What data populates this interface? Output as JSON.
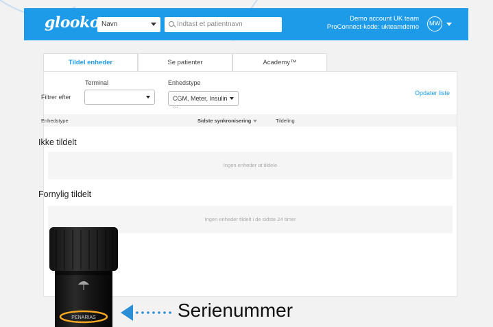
{
  "header": {
    "logo": "glooko",
    "filter_select": "Navn",
    "search_placeholder": "Indtast et patientnavn",
    "account_line1": "Demo account UK team",
    "account_line2": "ProConnect-kode: ukteamdemo",
    "avatar_initials": "MW",
    "color": "#1e9be8"
  },
  "tabs": [
    {
      "label": "Tildel enheder",
      "active": true
    },
    {
      "label": "Se patienter",
      "active": false
    },
    {
      "label": "Academy™",
      "active": false
    }
  ],
  "filters": {
    "filter_label": "Filtrer efter",
    "terminal_label": "Terminal",
    "terminal_value": "",
    "device_type_label": "Enhedstype",
    "device_type_value": "CGM, Meter, Insulin ...",
    "update_link": "Opdater liste"
  },
  "table": {
    "col_device_type": "Enhedstype",
    "col_last_sync": "Sidste synkronisering",
    "col_assignment": "Tildeling"
  },
  "sections": {
    "unassigned_title": "Ikke tildelt",
    "unassigned_empty": "Ingen enheder at tildele",
    "recent_title": "Fornylig tildelt",
    "recent_empty": "Ingen enheder tildelt i de sidste 24 timer"
  },
  "overlay": {
    "device_label": "PENARIAS",
    "annotation": "Serienummer",
    "highlight_color": "#f5a623",
    "arrow_color": "#2b8fd8"
  }
}
